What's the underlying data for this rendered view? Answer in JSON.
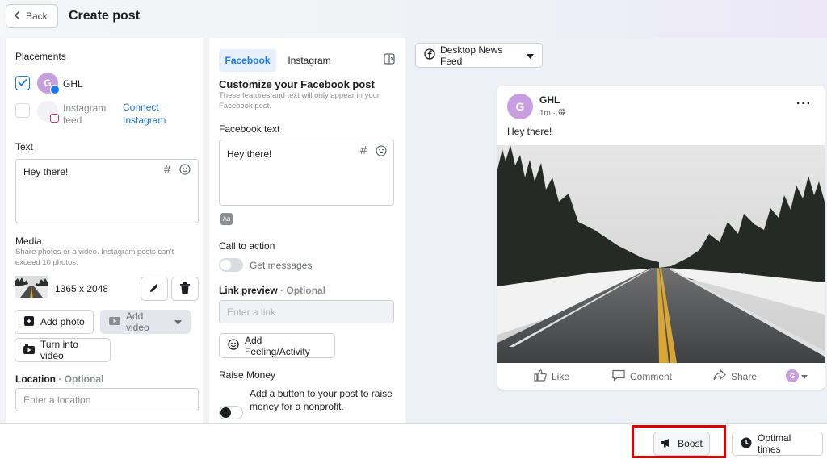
{
  "header": {
    "back_label": "Back",
    "title": "Create post"
  },
  "left": {
    "placements_label": "Placements",
    "account_name": "GHL",
    "account_initial": "G",
    "instagram_feed_label": "Instagram\nfeed",
    "connect_instagram": "Connect\nInstagram",
    "text_label": "Text",
    "text_value": "Hey there!",
    "media_label": "Media",
    "media_hint": "Share photos or a video. Instagram posts can't exceed 10 photos.",
    "media_dimensions": "1365 x 2048",
    "add_photo": "Add photo",
    "add_video": "Add video",
    "turn_into_video": "Turn into video",
    "location_label": "Location",
    "location_optional": "· Optional",
    "location_placeholder": "Enter a location"
  },
  "middle": {
    "tabs": [
      {
        "label": "Facebook",
        "active": true
      },
      {
        "label": "Instagram",
        "active": false
      }
    ],
    "customize_title": "Customize your Facebook post",
    "customize_hint": "These features and text will only appear in your Facebook post.",
    "facebook_text_label": "Facebook text",
    "facebook_text_value": "Hey there!",
    "cta_label": "Call to action",
    "cta_value": "Get messages",
    "link_preview_label": "Link preview",
    "link_preview_optional": "· Optional",
    "link_placeholder": "Enter a link",
    "feeling_button": "Add Feeling/Activity",
    "raise_money_label": "Raise Money",
    "raise_money_text": "Add a button to your post to raise money for a nonprofit."
  },
  "preview": {
    "placement_select": "Desktop News Feed",
    "page_name": "GHL",
    "initial": "G",
    "timestamp": "1m ·",
    "post_text": "Hey there!",
    "actions": [
      "Like",
      "Comment",
      "Share"
    ]
  },
  "footer": {
    "boost_label": "Boost",
    "optimal_times_label": "Optimal times",
    "highlight_color": "#e00000"
  }
}
